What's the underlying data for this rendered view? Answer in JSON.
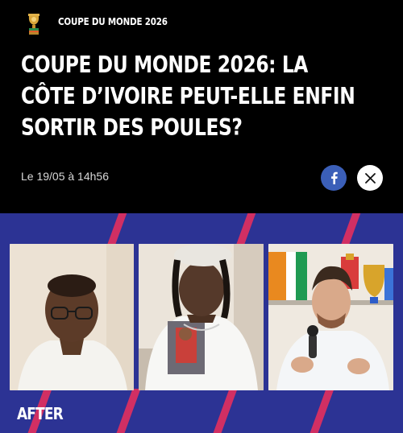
{
  "header": {
    "logo_icon": "trophy-icon",
    "category": "COUPE DU MONDE 2026"
  },
  "article": {
    "title_lines": [
      "COUPE DU MONDE 2026: LA",
      "CÔTE D’IVOIRE PEUT-ELLE ENFIN",
      "SORTIR DES POULES?"
    ],
    "date": "Le 19/05 à 14h56"
  },
  "share": {
    "facebook_icon": "facebook-icon",
    "x_icon": "x-icon"
  },
  "video": {
    "show_logo": "AFTER",
    "panels": [
      "guest-left",
      "guest-center",
      "host-right"
    ]
  },
  "colors": {
    "background": "#000000",
    "facebook": "#3b5fb8",
    "video_bg": "#2c3394",
    "stripe": "#d12f63"
  }
}
